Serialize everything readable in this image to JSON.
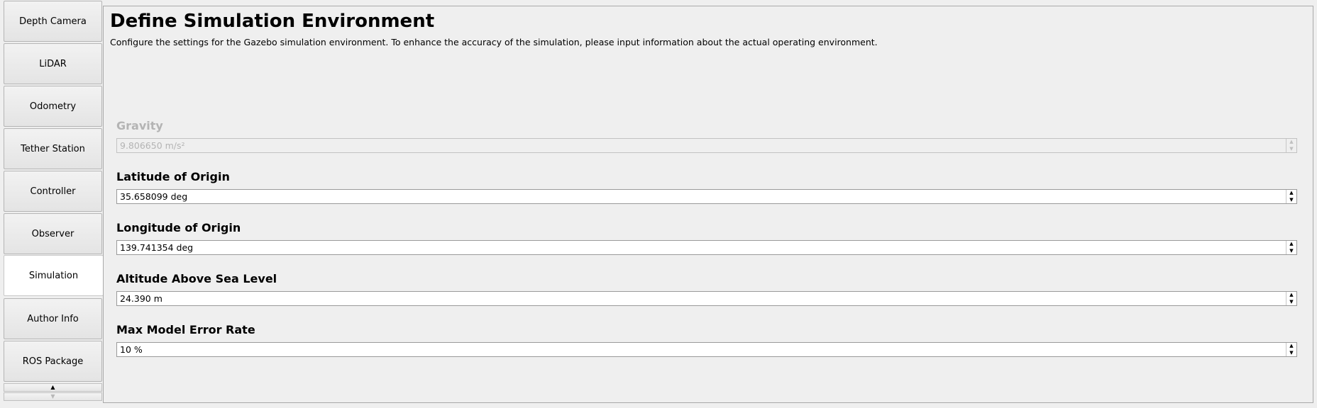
{
  "sidebar": {
    "items": [
      {
        "label": "Depth Camera"
      },
      {
        "label": "LiDAR"
      },
      {
        "label": "Odometry"
      },
      {
        "label": "Tether Station"
      },
      {
        "label": "Controller"
      },
      {
        "label": "Observer"
      },
      {
        "label": "Simulation",
        "active": true
      },
      {
        "label": "Author Info"
      },
      {
        "label": "ROS Package"
      }
    ],
    "scroll_up_glyph": "▲",
    "scroll_down_glyph": "▼"
  },
  "main": {
    "title": "Define Simulation Environment",
    "description": "Configure the settings for the Gazebo simulation environment. To enhance the accuracy of the simulation, please input information about the actual operating environment.",
    "fields": {
      "gravity": {
        "label": "Gravity",
        "value": "9.806650 m/s²",
        "enabled": false
      },
      "latitude": {
        "label": "Latitude of Origin",
        "value": "35.658099 deg",
        "enabled": true
      },
      "longitude": {
        "label": "Longitude of Origin",
        "value": "139.741354 deg",
        "enabled": true
      },
      "altitude": {
        "label": "Altitude Above Sea Level",
        "value": "24.390 m",
        "enabled": true
      },
      "error_rate": {
        "label": "Max Model Error Rate",
        "value": "10 %",
        "enabled": true
      }
    },
    "spin_up_glyph": "▲",
    "spin_down_glyph": "▼"
  },
  "colors": {
    "background": "#efefef",
    "disabled_text": "#b4b4b4",
    "active_tab": "#ffffff"
  }
}
